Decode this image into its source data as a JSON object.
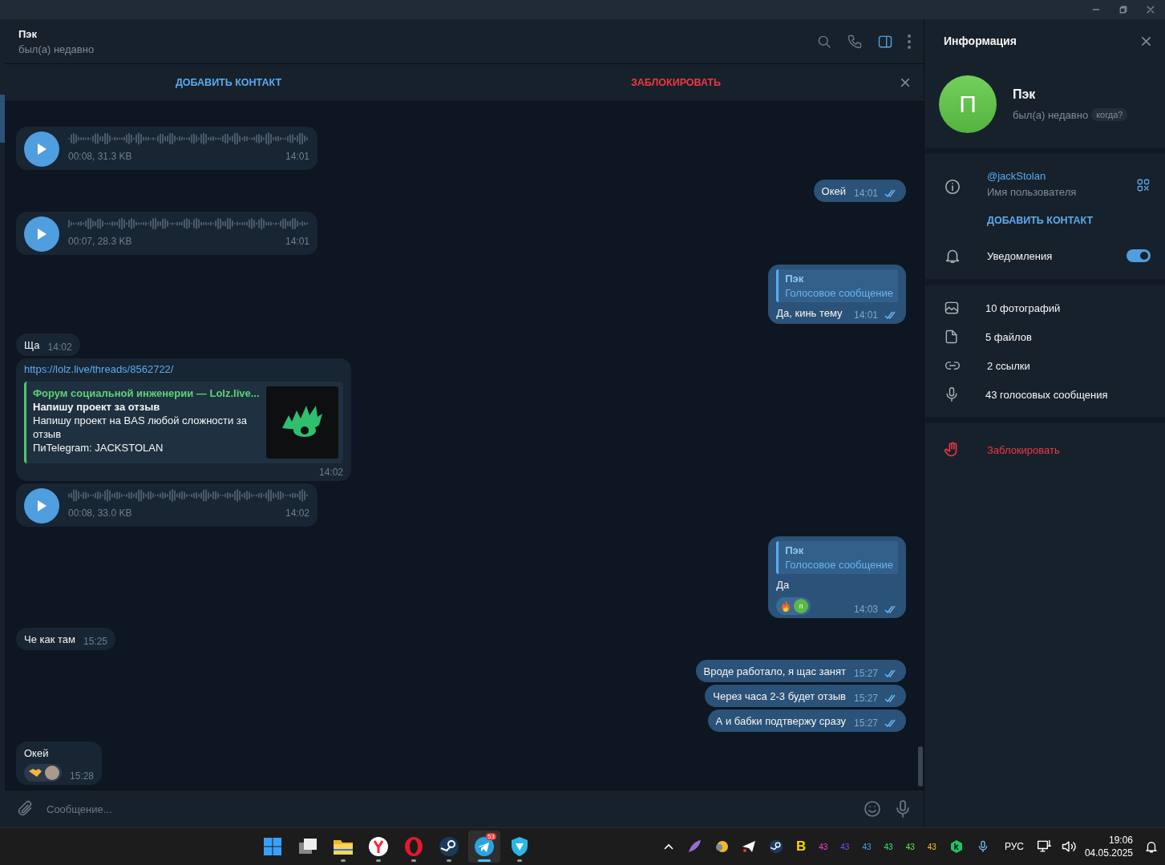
{
  "chat_header": {
    "name": "Пэк",
    "status": "был(а) недавно"
  },
  "action_bar": {
    "add_contact": "ДОБАВИТЬ КОНТАКТ",
    "block": "ЗАБЛОКИРОВАТЬ"
  },
  "messages": [
    {
      "kind": "voice",
      "outgoing": false,
      "info": "00:08, 31.3 KB",
      "time": "14:01"
    },
    {
      "kind": "text",
      "outgoing": true,
      "text": "Окей",
      "time": "14:01",
      "read": true
    },
    {
      "kind": "voice",
      "outgoing": false,
      "info": "00:07, 28.3 KB",
      "time": "14:01"
    },
    {
      "kind": "reply",
      "outgoing": true,
      "reply_to": "Пэк",
      "reply_text": "Голосовое сообщение",
      "text": "Да, кинь тему",
      "time": "14:01",
      "read": true
    },
    {
      "kind": "text",
      "outgoing": false,
      "text": "Ща",
      "time": "14:02"
    },
    {
      "kind": "link",
      "outgoing": false,
      "url": "https://lolz.live/threads/8562722/",
      "preview": {
        "site": "Форум социальной инженерии —  Lolz.live...",
        "title": "Напишу проект за отзыв",
        "description": [
          "Напишу проект на BAS любой сложности за отзыв",
          "ПиTelegram: JACKSTOLAN"
        ]
      },
      "time": "14:02"
    },
    {
      "kind": "voice",
      "outgoing": false,
      "info": "00:08, 33.0 KB",
      "time": "14:02"
    },
    {
      "kind": "reply",
      "outgoing": true,
      "reply_to": "Пэк",
      "reply_text": "Голосовое сообщение",
      "text": "Да",
      "reactions": [
        {
          "kind": "fire",
          "avatar_letter": "п"
        }
      ],
      "time": "14:03",
      "read": true
    },
    {
      "kind": "text",
      "outgoing": false,
      "text": "Че как там",
      "time": "15:25"
    },
    {
      "kind": "text",
      "outgoing": true,
      "text": "Вроде работало, я щас занят",
      "time": "15:27",
      "read": true
    },
    {
      "kind": "text",
      "outgoing": true,
      "text": "Через часа 2-3 будет отзыв",
      "time": "15:27",
      "read": true
    },
    {
      "kind": "text",
      "outgoing": true,
      "text": "А и бабки подтвержу сразу",
      "time": "15:27",
      "read": true
    },
    {
      "kind": "text",
      "outgoing": false,
      "text": "Окей",
      "reactions": [
        {
          "kind": "handshake"
        }
      ],
      "time": "15:28"
    }
  ],
  "composer": {
    "placeholder": "Сообщение..."
  },
  "info_panel": {
    "title": "Информация",
    "avatar_letter": "П",
    "name": "Пэк",
    "status": "был(а) недавно",
    "when_chip": "когда?",
    "username": "@jackStolan",
    "username_label": "Имя пользователя",
    "add_contact": "ДОБАВИТЬ КОНТАКТ",
    "notifications": {
      "label": "Уведомления",
      "on": true
    },
    "media": [
      {
        "kind": "photos",
        "label": "10 фотографий"
      },
      {
        "kind": "files",
        "label": "5 файлов"
      },
      {
        "kind": "links",
        "label": "2 ссылки"
      },
      {
        "kind": "voice",
        "label": "43 голосовых сообщения"
      }
    ],
    "block": "Заблокировать"
  },
  "taskbar": {
    "apps": [
      {
        "kind": "start",
        "selected": false,
        "running": false
      },
      {
        "kind": "taskview",
        "selected": false,
        "running": false
      },
      {
        "kind": "explorer",
        "selected": false,
        "running": true
      },
      {
        "kind": "yandex",
        "selected": false,
        "running": true
      },
      {
        "kind": "opera",
        "selected": false,
        "running": true
      },
      {
        "kind": "steam",
        "selected": false,
        "running": true
      },
      {
        "kind": "telegram",
        "selected": true,
        "running": true,
        "badge": "53"
      },
      {
        "kind": "shield",
        "selected": false,
        "running": true
      }
    ],
    "tray": [
      {
        "kind": "chevron"
      },
      {
        "kind": "feather"
      },
      {
        "kind": "coin"
      },
      {
        "kind": "plane"
      },
      {
        "kind": "steam"
      },
      {
        "kind": "letter",
        "label": "B"
      },
      {
        "kind": "counter",
        "label": "43",
        "color": "#ff3ddc"
      },
      {
        "kind": "counter",
        "label": "43",
        "color": "#7b4dff"
      },
      {
        "kind": "counter",
        "label": "43",
        "color": "#35a8ff"
      },
      {
        "kind": "counter",
        "label": "43",
        "color": "#2ee87a"
      },
      {
        "kind": "counter",
        "label": "43",
        "color": "#5cf23c"
      },
      {
        "kind": "counter",
        "label": "43",
        "color": "#ffc21a"
      },
      {
        "kind": "kbadge"
      },
      {
        "kind": "mic"
      }
    ],
    "language": "РУС",
    "time": "19:06",
    "date": "04.05.2025"
  }
}
